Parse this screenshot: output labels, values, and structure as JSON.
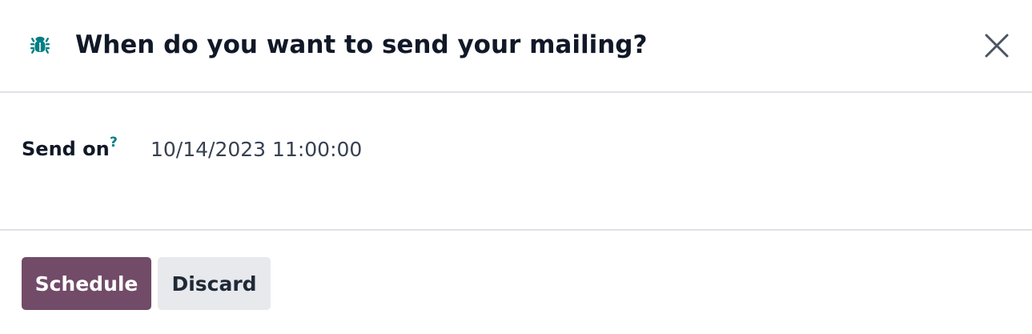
{
  "dialog": {
    "title": "When do you want to send your mailing?",
    "icons": {
      "debug": "bug-icon",
      "close": "close-icon"
    }
  },
  "form": {
    "send_on": {
      "label": "Send on",
      "help_marker": "?",
      "value": "10/14/2023 11:00:00"
    }
  },
  "footer": {
    "schedule_label": "Schedule",
    "discard_label": "Discard"
  },
  "colors": {
    "primary_button": "#714b67",
    "secondary_button": "#e7e9ed",
    "accent_teal": "#017e84",
    "divider": "#dee2e6"
  }
}
